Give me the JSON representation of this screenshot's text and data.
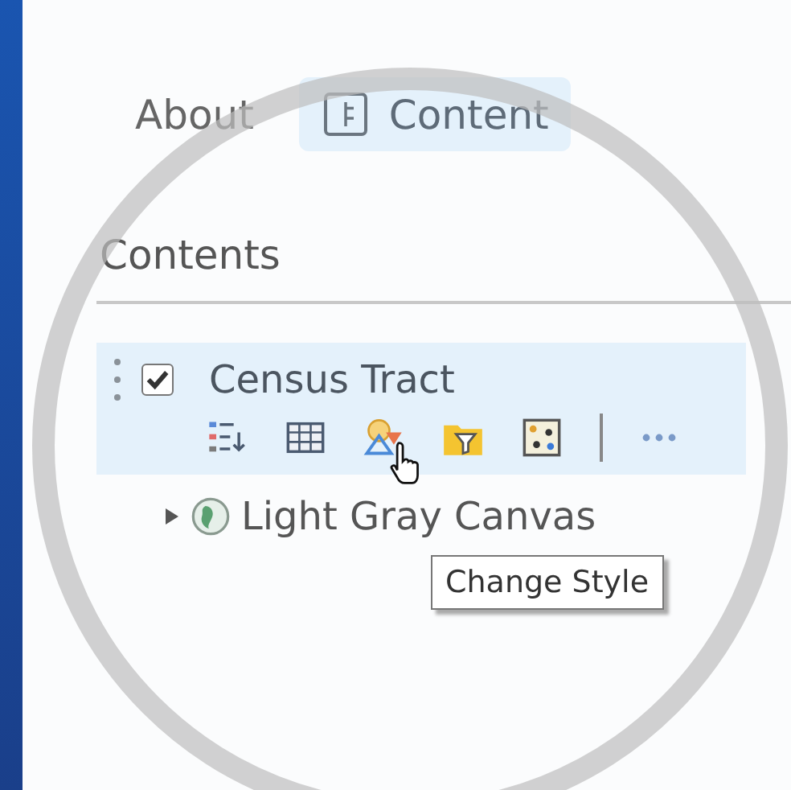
{
  "tabs": [
    {
      "label": "About",
      "selected": false
    },
    {
      "label": "Content",
      "selected": true
    }
  ],
  "heading": "Contents",
  "layer": {
    "name": "Census Tract",
    "checked": true,
    "selected": true,
    "tools": [
      {
        "kind": "legend"
      },
      {
        "kind": "table"
      },
      {
        "kind": "style"
      },
      {
        "kind": "filter"
      },
      {
        "kind": "analysis"
      }
    ]
  },
  "basemap": {
    "name": "Light Gray Canvas",
    "expanded": false
  },
  "tooltip": "Change Style"
}
